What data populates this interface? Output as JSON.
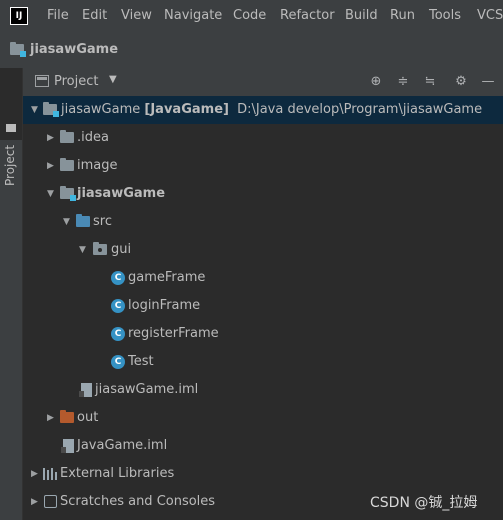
{
  "app": {
    "logo": "IJ"
  },
  "menu": [
    "File",
    "Edit",
    "View",
    "Navigate",
    "Code",
    "Refactor",
    "Build",
    "Run",
    "Tools",
    "VCS"
  ],
  "navbar": {
    "title": "jiasawGame"
  },
  "side_tab": {
    "label": "Project"
  },
  "panel": {
    "title": "Project",
    "tools": [
      "locate-icon",
      "expand-all-icon",
      "collapse-all-icon",
      "gear-icon",
      "hide-icon"
    ]
  },
  "tree": {
    "root": {
      "name": "jiasawGame",
      "module": "[JavaGame]",
      "path": "D:\\Java develop\\Program\\jiasawGame"
    },
    "idea": ".idea",
    "image": "image",
    "module": "jiasawGame",
    "src": "src",
    "gui": "gui",
    "classes": [
      "gameFrame",
      "loginFrame",
      "registerFrame",
      "Test"
    ],
    "module_iml": "jiasawGame.iml",
    "out": "out",
    "project_iml": "JavaGame.iml",
    "external_libraries": "External Libraries",
    "scratches": "Scratches and Consoles"
  },
  "watermark": "CSDN @铖_拉姆"
}
